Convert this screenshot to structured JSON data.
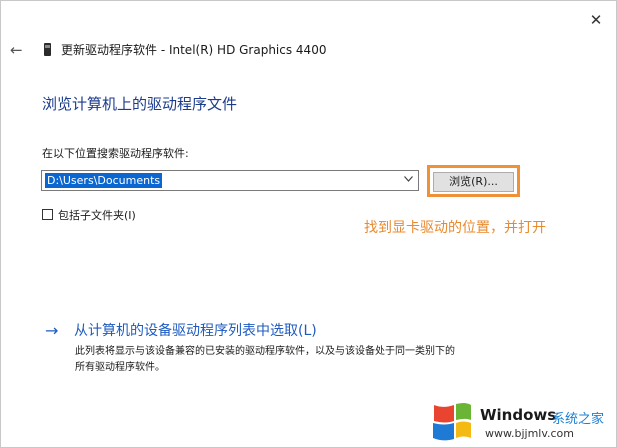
{
  "window": {
    "close_glyph": "✕",
    "back_glyph": "←",
    "title": "更新驱动程序软件 - Intel(R) HD Graphics 4400"
  },
  "main": {
    "heading": "浏览计算机上的驱动程序文件",
    "search_label": "在以下位置搜索驱动程序软件:",
    "path_value": "D:\\Users\\Documents",
    "browse_button": "浏览(R)...",
    "include_subfolders": "包括子文件夹(I)",
    "include_subfolders_checked": false,
    "annotation": "找到显卡驱动的位置，并打开",
    "pick_link": {
      "arrow": "→",
      "label": "从计算机的设备驱动程序列表中选取(L)",
      "description_line1": "此列表将显示与该设备兼容的已安装的驱动程序软件，以及与该设备处于同一类别下的",
      "description_line2": "所有驱动程序软件。"
    }
  },
  "watermark": {
    "brand": "Windows",
    "site_name": "系统之家",
    "url": "www.bjjmlv.com"
  },
  "colors": {
    "accent_blue": "#1f5bbf",
    "heading_blue": "#1b3b8c",
    "selection_blue": "#0a66d0",
    "annotation_orange": "#e98a2e",
    "highlight_orange": "#f0913a"
  },
  "icons": {
    "close": "close-icon",
    "back": "back-arrow-icon",
    "device": "graphics-device-icon",
    "dropdown": "chevron-down-icon",
    "link_arrow": "arrow-right-icon",
    "logo": "windows-logo-icon"
  }
}
